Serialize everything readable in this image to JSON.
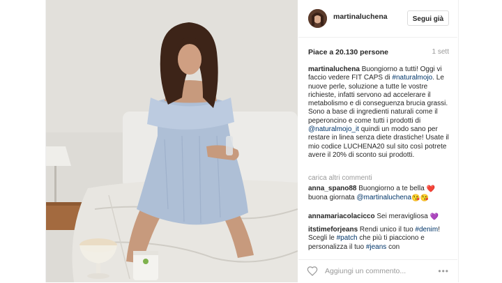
{
  "post": {
    "username": "martinaluchena",
    "follow_label": "Segui già",
    "likes": "Piace a 20.130 persone",
    "time": "1 sett",
    "caption": {
      "username": "martinaluchena",
      "text_1": " Buongiorno a tutti! Oggi vi faccio vedere FIT CAPS di ",
      "hashtag_1": "#naturalmojo",
      "text_2": ". Le nuove perle, soluzione a tutte le vostre richieste, infatti servono ad accelerare il metabolismo e di conseguenza brucia grassi. Sono a base di ingredienti naturali come il peperoncino e come tutti i prodotti di ",
      "mention_1": "@naturalmojo_it",
      "text_3": " quindi un modo sano per restare in linea senza diete drastiche! Usate il mio codice LUCHENA20 sul sito così potrete avere il 20% di sconto sui prodotti."
    },
    "load_more": "carica altri commenti",
    "comments": [
      {
        "username": "anna_spano88",
        "text_1": " Buongiorno a te bella ",
        "emoji_1": "❤️",
        "text_2": " buona giornata ",
        "mention": "@martinaluchena",
        "emoji_2": "😘😘",
        "text_3": ""
      },
      {
        "username": "annamariacolacicco",
        "text_1": " Sei meravigliosa ",
        "emoji_1": "💜"
      },
      {
        "username": "itstimeforjeans",
        "text_1": " Rendi unico il tuo ",
        "hashtag_1": "#denim",
        "text_2": "! Scegli le ",
        "hashtag_2": "#patch",
        "text_3": " che più ti piacciono e personalizza il tuo ",
        "hashtag_3": "#jeans",
        "text_4": " con"
      }
    ],
    "add_comment_placeholder": "Aggiungi un commento...",
    "more_label": "•••",
    "product_label": "FIT CAPS"
  }
}
